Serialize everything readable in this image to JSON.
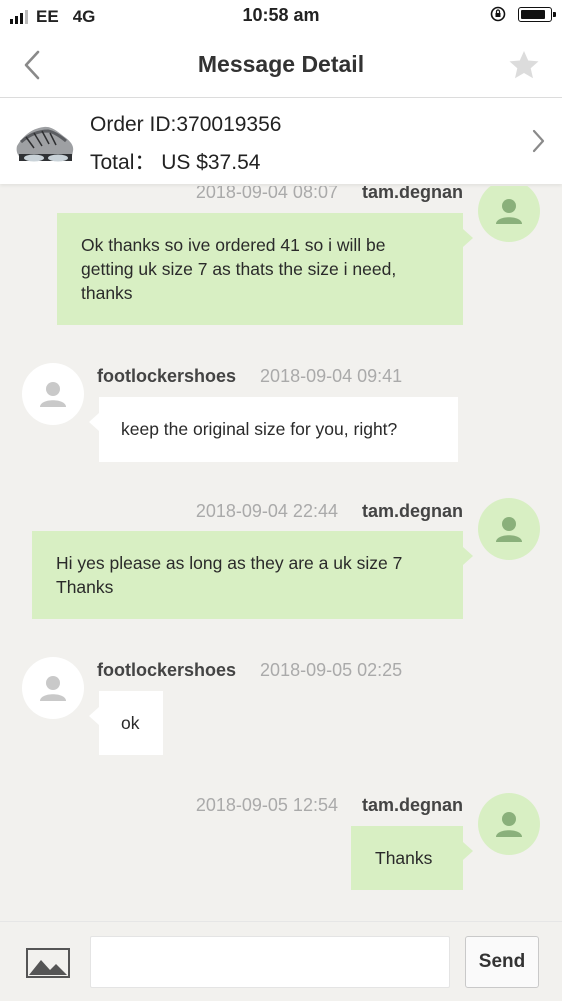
{
  "status_bar": {
    "carrier": "EE",
    "network": "4G",
    "time": "10:58 am"
  },
  "nav": {
    "title": "Message Detail",
    "back_icon": "chevron-left-icon",
    "star_icon": "star-icon"
  },
  "order": {
    "id_label": "Order ID:370019356",
    "total_label": "Total：  US $37.54"
  },
  "messages": [
    {
      "time": "2018-09-04 08:07",
      "sender": "tam.degnan",
      "text": "Ok thanks so ive ordered 41 so i will be getting uk size 7 as thats the size i need, thanks"
    },
    {
      "time": "2018-09-04 09:41",
      "sender": "footlockershoes",
      "text": "keep the original size for you, right?"
    },
    {
      "time": "2018-09-04 22:44",
      "sender": "tam.degnan",
      "text": "Hi yes please as long as they are a uk size 7 Thanks"
    },
    {
      "time": "2018-09-05 02:25",
      "sender": "footlockershoes",
      "text": "ok"
    },
    {
      "time": "2018-09-05 12:54",
      "sender": "tam.degnan",
      "text": "Thanks"
    }
  ],
  "composer": {
    "input_value": "",
    "send_label": "Send"
  },
  "colors": {
    "my_bubble": "#d8efc3",
    "their_bubble": "#ffffff",
    "background": "#f2f1ee"
  }
}
